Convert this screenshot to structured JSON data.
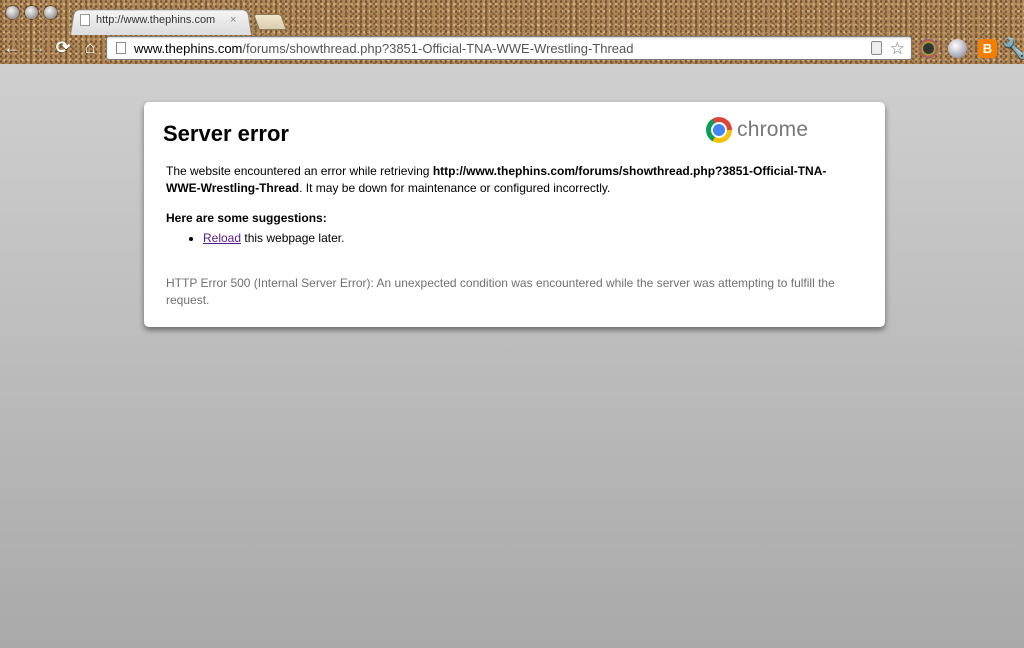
{
  "tab": {
    "title": "http://www.thephins.com",
    "close_glyph": "×"
  },
  "toolbar": {
    "back_glyph": "←",
    "forward_glyph": "→",
    "reload_glyph": "⟳",
    "home_glyph": "⌂",
    "wrench_glyph": "🔧",
    "blogger_glyph": "B"
  },
  "omnibox": {
    "domain": "www.thephins.com",
    "path": "/forums/showthread.php?3851-Official-TNA-WWE-Wrestling-Thread",
    "star_glyph": "☆"
  },
  "icons": [
    "page-icon",
    "star-icon",
    "extension-icon",
    "globe-icon",
    "blogger-icon",
    "wrench-icon",
    "chrome-logo-icon"
  ],
  "error": {
    "logo_text": "chrome",
    "title": "Server error",
    "message_pre": "The website encountered an error while retrieving ",
    "message_url": "http://www.thephins.com/forums/showthread.php?3851-Official-TNA-WWE-Wrestling-Thread",
    "message_post": ". It may be down for maintenance or configured incorrectly.",
    "suggestions_heading": "Here are some suggestions:",
    "suggestion_link": "Reload",
    "suggestion_rest": " this webpage later.",
    "detail": "HTTP Error 500 (Internal Server Error): An unexpected condition was encountered while the server was attempting to fulfill the request."
  }
}
